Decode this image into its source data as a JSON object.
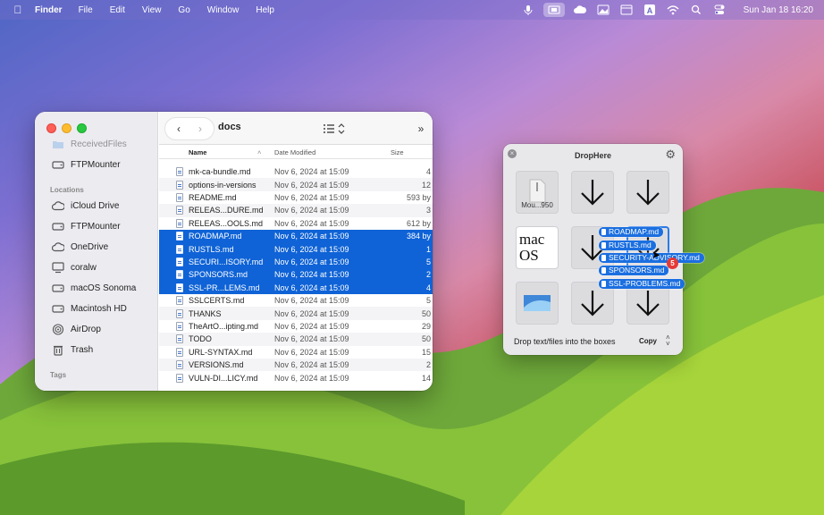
{
  "menubar": {
    "app": "Finder",
    "menus": [
      "File",
      "Edit",
      "View",
      "Go",
      "Window",
      "Help"
    ],
    "clock": "Sun Jan 18  16:20",
    "status_icons": [
      "microphone-icon",
      "screen-share-icon",
      "cloud-icon",
      "image-icon",
      "window-icon",
      "text-input-icon",
      "wifi-icon",
      "search-icon",
      "control-center-icon"
    ]
  },
  "finder": {
    "title": "docs",
    "sidebar": {
      "partial_item": "ReceivedFiles",
      "items_top": [
        {
          "label": "FTPMounter",
          "icon": "drive-icon"
        }
      ],
      "locations_header": "Locations",
      "locations": [
        {
          "label": "iCloud Drive",
          "icon": "cloud-icon"
        },
        {
          "label": "FTPMounter",
          "icon": "drive-icon"
        },
        {
          "label": "OneDrive",
          "icon": "cloud-icon"
        },
        {
          "label": "coralw",
          "icon": "computer-icon"
        },
        {
          "label": "macOS Sonoma",
          "icon": "drive-icon"
        },
        {
          "label": "Macintosh HD",
          "icon": "drive-icon"
        },
        {
          "label": "AirDrop",
          "icon": "airdrop-icon"
        },
        {
          "label": "Trash",
          "icon": "trash-icon"
        }
      ],
      "tags_header": "Tags"
    },
    "columns": {
      "name": "Name",
      "date": "Date Modified",
      "size": "Size"
    },
    "rows": [
      {
        "name": "mk-ca-bundle.md",
        "date": "Nov 6, 2024 at 15:09",
        "size": "4",
        "selected": false
      },
      {
        "name": "options-in-versions",
        "date": "Nov 6, 2024 at 15:09",
        "size": "12",
        "selected": false
      },
      {
        "name": "README.md",
        "date": "Nov 6, 2024 at 15:09",
        "size": "593 by",
        "selected": false
      },
      {
        "name": "RELEAS...DURE.md",
        "date": "Nov 6, 2024 at 15:09",
        "size": "3",
        "selected": false
      },
      {
        "name": "RELEAS...OOLS.md",
        "date": "Nov 6, 2024 at 15:09",
        "size": "612 by",
        "selected": false
      },
      {
        "name": "ROADMAP.md",
        "date": "Nov 6, 2024 at 15:09",
        "size": "384 by",
        "selected": true
      },
      {
        "name": "RUSTLS.md",
        "date": "Nov 6, 2024 at 15:09",
        "size": "1",
        "selected": true
      },
      {
        "name": "SECURI...ISORY.md",
        "date": "Nov 6, 2024 at 15:09",
        "size": "5",
        "selected": true
      },
      {
        "name": "SPONSORS.md",
        "date": "Nov 6, 2024 at 15:09",
        "size": "2",
        "selected": true
      },
      {
        "name": "SSL-PR...LEMS.md",
        "date": "Nov 6, 2024 at 15:09",
        "size": "4",
        "selected": true
      },
      {
        "name": "SSLCERTS.md",
        "date": "Nov 6, 2024 at 15:09",
        "size": "5",
        "selected": false
      },
      {
        "name": "THANKS",
        "date": "Nov 6, 2024 at 15:09",
        "size": "50",
        "selected": false
      },
      {
        "name": "TheArtO...ipting.md",
        "date": "Nov 6, 2024 at 15:09",
        "size": "29",
        "selected": false
      },
      {
        "name": "TODO",
        "date": "Nov 6, 2024 at 15:09",
        "size": "50",
        "selected": false
      },
      {
        "name": "URL-SYNTAX.md",
        "date": "Nov 6, 2024 at 15:09",
        "size": "15",
        "selected": false
      },
      {
        "name": "VERSIONS.md",
        "date": "Nov 6, 2024 at 15:09",
        "size": "2",
        "selected": false
      },
      {
        "name": "VULN-DI...LICY.md",
        "date": "Nov 6, 2024 at 15:09",
        "size": "14",
        "selected": false
      }
    ]
  },
  "drophere": {
    "title": "DropHere",
    "file_cell_label": "Mou...950",
    "macos_text": "mac OS",
    "hint": "Drop text/files into the boxes",
    "action": "Copy",
    "drag_items": [
      "ROADMAP.md",
      "RUSTLS.md",
      "SECURITY-ADVISORY.md",
      "SPONSORS.md",
      "SSL-PROBLEMS.md"
    ],
    "drag_count": "5"
  }
}
